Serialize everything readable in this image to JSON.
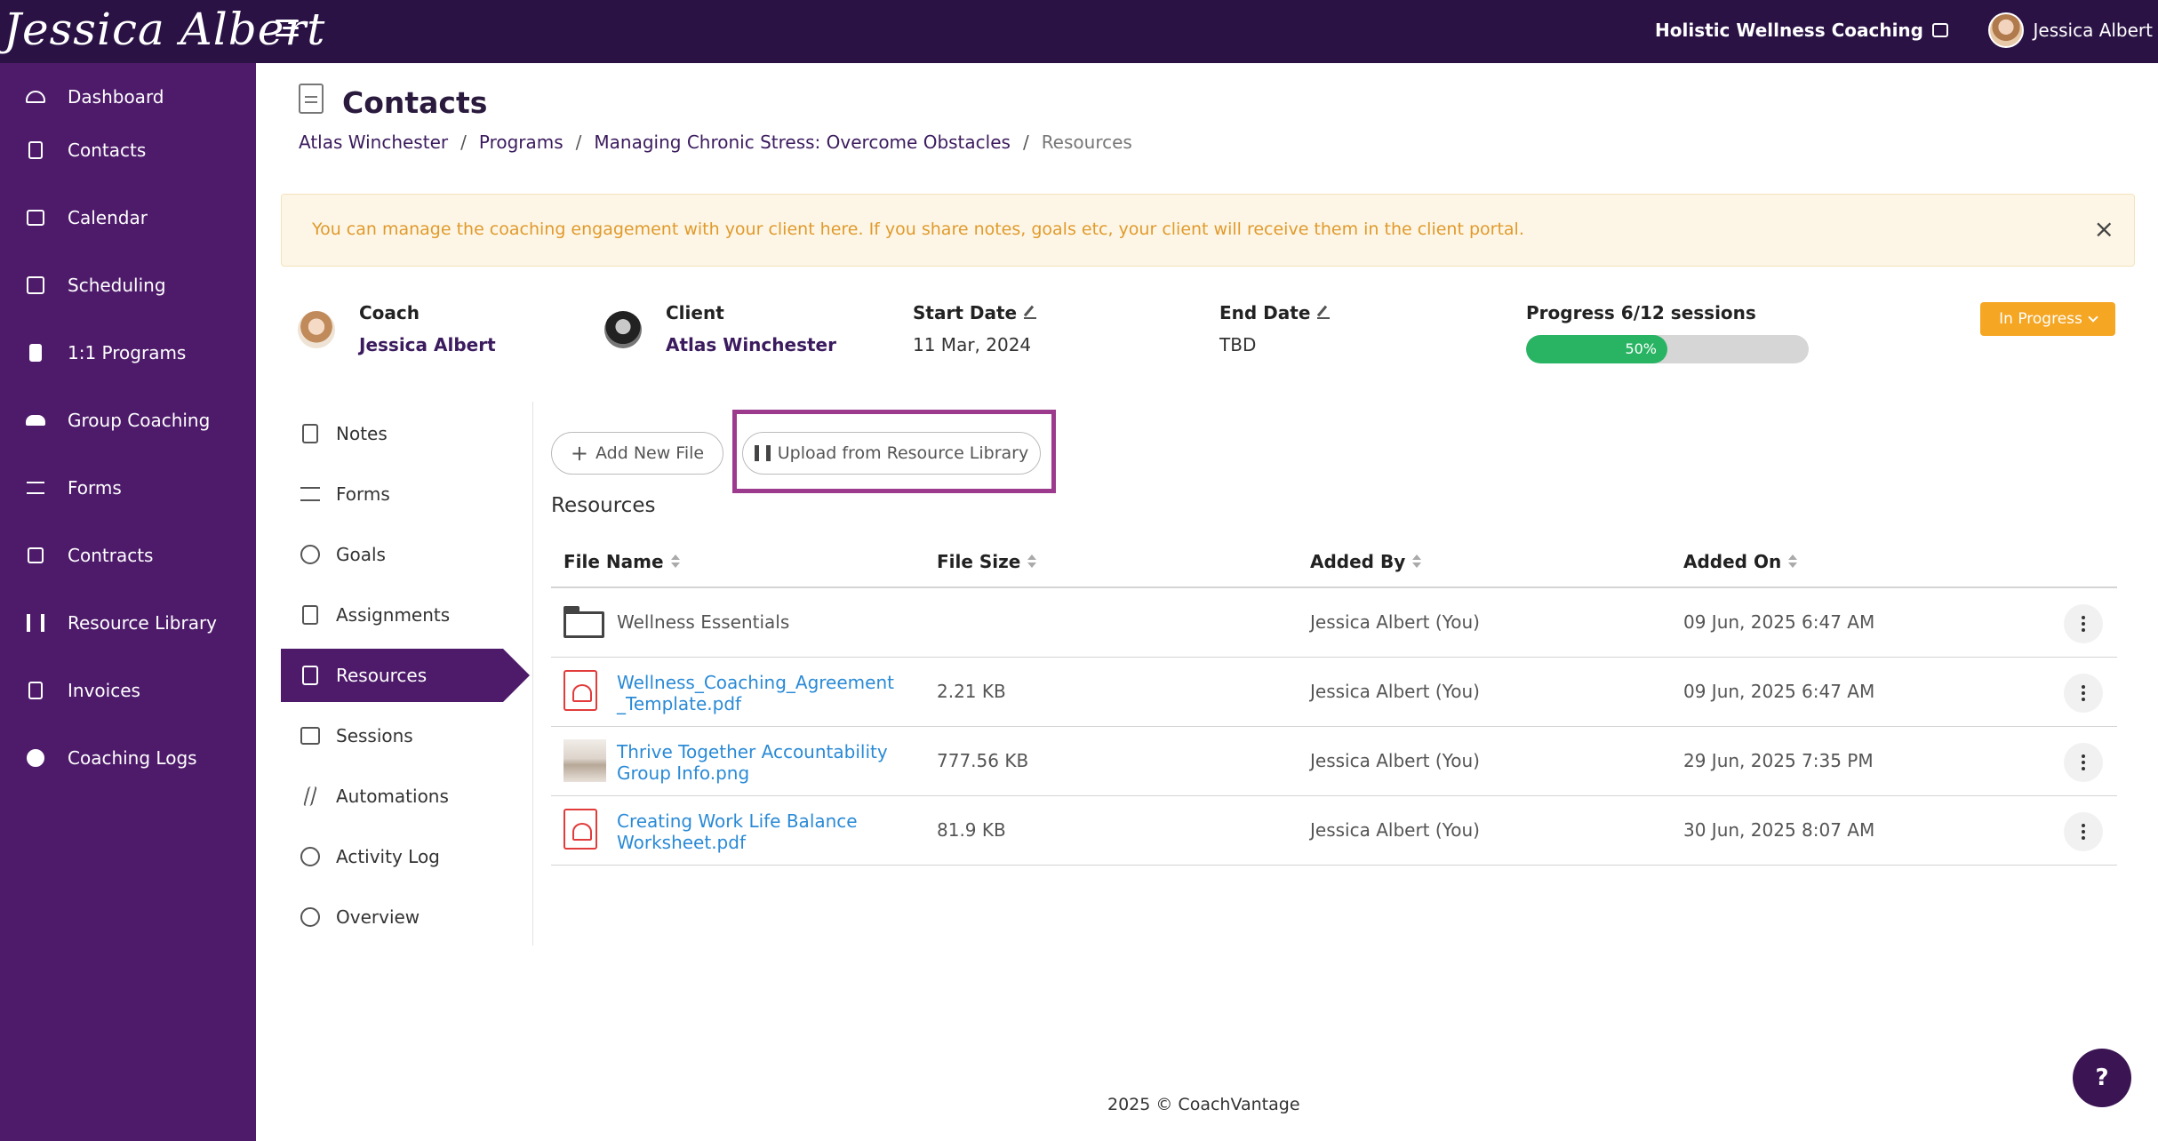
{
  "brand": {
    "logo_text": "Jessica Albert"
  },
  "topbar": {
    "business_name": "Holistic Wellness Coaching",
    "user_name": "Jessica Albert"
  },
  "sidebar": {
    "items": [
      {
        "label": "Dashboard",
        "icon": "dashboard-icon"
      },
      {
        "label": "Contacts",
        "icon": "contacts-icon"
      },
      {
        "label": "Calendar",
        "icon": "calendar-icon"
      },
      {
        "label": "Scheduling",
        "icon": "scheduling-icon"
      },
      {
        "label": "1:1 Programs",
        "icon": "book-icon"
      },
      {
        "label": "Group Coaching",
        "icon": "group-icon"
      },
      {
        "label": "Forms",
        "icon": "checklist-icon"
      },
      {
        "label": "Contracts",
        "icon": "contract-icon"
      },
      {
        "label": "Resource Library",
        "icon": "library-icon"
      },
      {
        "label": "Invoices",
        "icon": "invoice-icon"
      },
      {
        "label": "Coaching Logs",
        "icon": "clock-icon"
      }
    ]
  },
  "page": {
    "title": "Contacts"
  },
  "breadcrumb": {
    "items": [
      "Atlas Winchester",
      "Programs",
      "Managing Chronic Stress: Overcome Obstacles"
    ],
    "current": "Resources",
    "separator": "/"
  },
  "alert": {
    "text": "You can manage the coaching engagement with your client here. If you share notes, goals etc, your client will receive them in the client portal.",
    "close": "×"
  },
  "engagement": {
    "coach_label": "Coach",
    "coach_name": "Jessica Albert",
    "client_label": "Client",
    "client_name": "Atlas Winchester",
    "start_label": "Start Date",
    "start_value": "11 Mar, 2024",
    "end_label": "End Date",
    "end_value": "TBD",
    "progress_label": "Progress 6/12 sessions",
    "progress_text": "50%",
    "progress_fraction": 0.5,
    "status": "In Progress"
  },
  "subnav": {
    "items": [
      {
        "label": "Notes",
        "icon": "notes-icon"
      },
      {
        "label": "Forms",
        "icon": "checklist-icon"
      },
      {
        "label": "Goals",
        "icon": "target-icon"
      },
      {
        "label": "Assignments",
        "icon": "clipboard-icon"
      },
      {
        "label": "Resources",
        "icon": "book-icon",
        "active": true
      },
      {
        "label": "Sessions",
        "icon": "calendar-icon"
      },
      {
        "label": "Automations",
        "icon": "bolt-icon"
      },
      {
        "label": "Activity Log",
        "icon": "history-icon"
      },
      {
        "label": "Overview",
        "icon": "info-icon"
      }
    ]
  },
  "actions": {
    "add_file": "Add New File",
    "upload_library": "Upload from Resource Library"
  },
  "resources": {
    "title": "Resources",
    "columns": [
      "File Name",
      "File Size",
      "Added By",
      "Added On"
    ],
    "rows": [
      {
        "type": "folder",
        "name": "Wellness Essentials",
        "size": "",
        "added_by": "Jessica Albert (You)",
        "added_on": "09 Jun, 2025 6:47 AM"
      },
      {
        "type": "pdf",
        "name_line1": "Wellness_Coaching_Agreement",
        "name_line2": "_Template.pdf",
        "size": "2.21 KB",
        "added_by": "Jessica Albert (You)",
        "added_on": "09 Jun, 2025 6:47 AM"
      },
      {
        "type": "image",
        "name_line1": "Thrive Together Accountability",
        "name_line2": "Group Info.png",
        "size": "777.56 KB",
        "added_by": "Jessica Albert (You)",
        "added_on": "29 Jun, 2025 7:35 PM"
      },
      {
        "type": "pdf",
        "name_line1": "Creating Work Life Balance",
        "name_line2": "Worksheet.pdf",
        "size": "81.9 KB",
        "added_by": "Jessica Albert (You)",
        "added_on": "30 Jun, 2025 8:07 AM"
      }
    ]
  },
  "footer": {
    "text": "2025 © CoachVantage"
  },
  "help": {
    "label": "?"
  }
}
